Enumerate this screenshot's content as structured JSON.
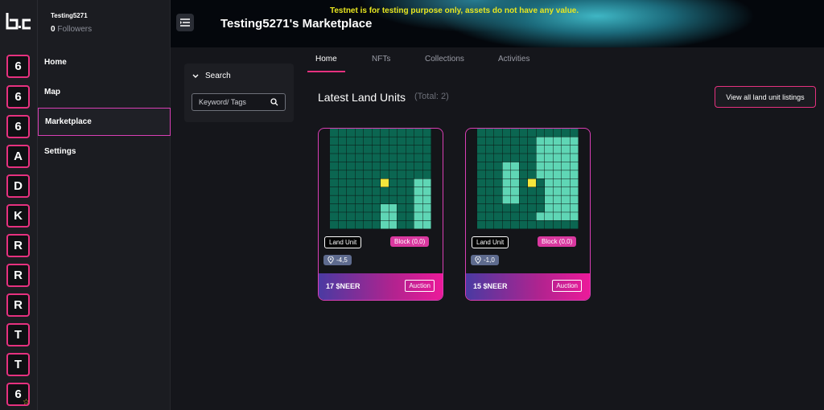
{
  "profile": {
    "name": "Testing5271",
    "followers_count": "0",
    "followers_label": "Followers"
  },
  "rail": {
    "tiles": [
      "6",
      "6",
      "6",
      "A",
      "D",
      "K",
      "R",
      "R",
      "R",
      "T",
      "T",
      "6"
    ],
    "last_tile_badge": "star-icon"
  },
  "nav": {
    "items": [
      "Home",
      "Map",
      "Marketplace",
      "Settings"
    ],
    "active": "Marketplace"
  },
  "banner": {
    "title": "Testing5271's Marketplace",
    "notice": "Testnet is for testing purpose only, assets do not have any value."
  },
  "search": {
    "label": "Search",
    "placeholder": "Keyword/ Tags"
  },
  "tabs": {
    "items": [
      "Home",
      "NFTs",
      "Collections",
      "Activities"
    ],
    "active": "Home"
  },
  "section": {
    "title": "Latest Land Units",
    "total": "(Total: 2)",
    "view_all": "View all land unit listings"
  },
  "cards": [
    {
      "type": "Land Unit",
      "block": "Block (0,0)",
      "coords": "-4,5",
      "price": "17 $NEER",
      "sale_type": "Auction"
    },
    {
      "type": "Land Unit",
      "block": "Block (0,0)",
      "coords": "-1,0",
      "price": "15 $NEER",
      "sale_type": "Auction"
    }
  ],
  "colors": {
    "accent": "#e6317f",
    "grid": "#0b6651",
    "land_highlight": "#5fd6b5",
    "marker": "#f5e63c",
    "notice": "#e8e620"
  }
}
